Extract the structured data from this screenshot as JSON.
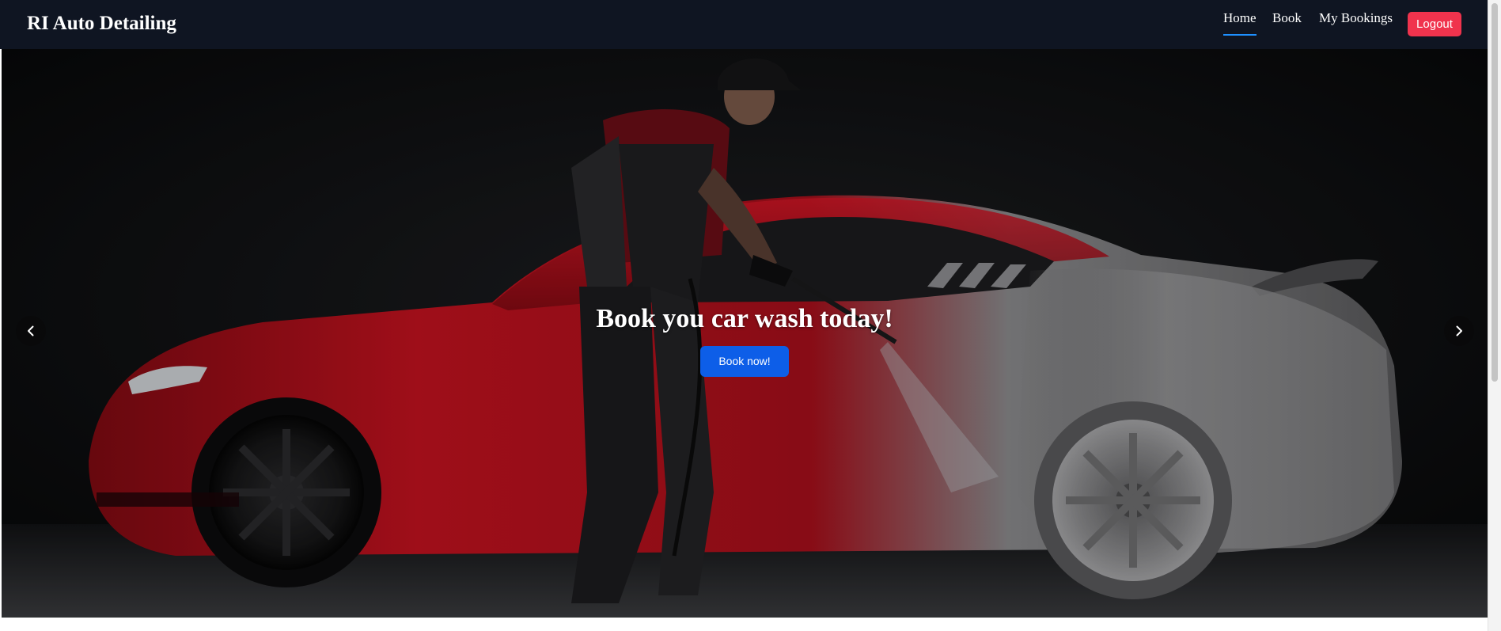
{
  "navbar": {
    "brand": "RI Auto Detailing",
    "links": [
      {
        "label": "Home",
        "active": true
      },
      {
        "label": "Book",
        "active": false
      },
      {
        "label": "My Bookings",
        "active": false
      }
    ],
    "logout_label": "Logout"
  },
  "hero": {
    "heading": "Book you car wash today!",
    "cta_label": "Book now!",
    "prev_icon": "chevron-left-icon",
    "next_icon": "chevron-right-icon",
    "image_subject": "detailer pressure-washing a red sports car covered in foam"
  },
  "colors": {
    "navbar_bg": "#0f1522",
    "logout_bg": "#f0334d",
    "cta_bg": "#0d5ee8",
    "active_underline": "#1e90ff",
    "car_red": "#c0121f"
  }
}
